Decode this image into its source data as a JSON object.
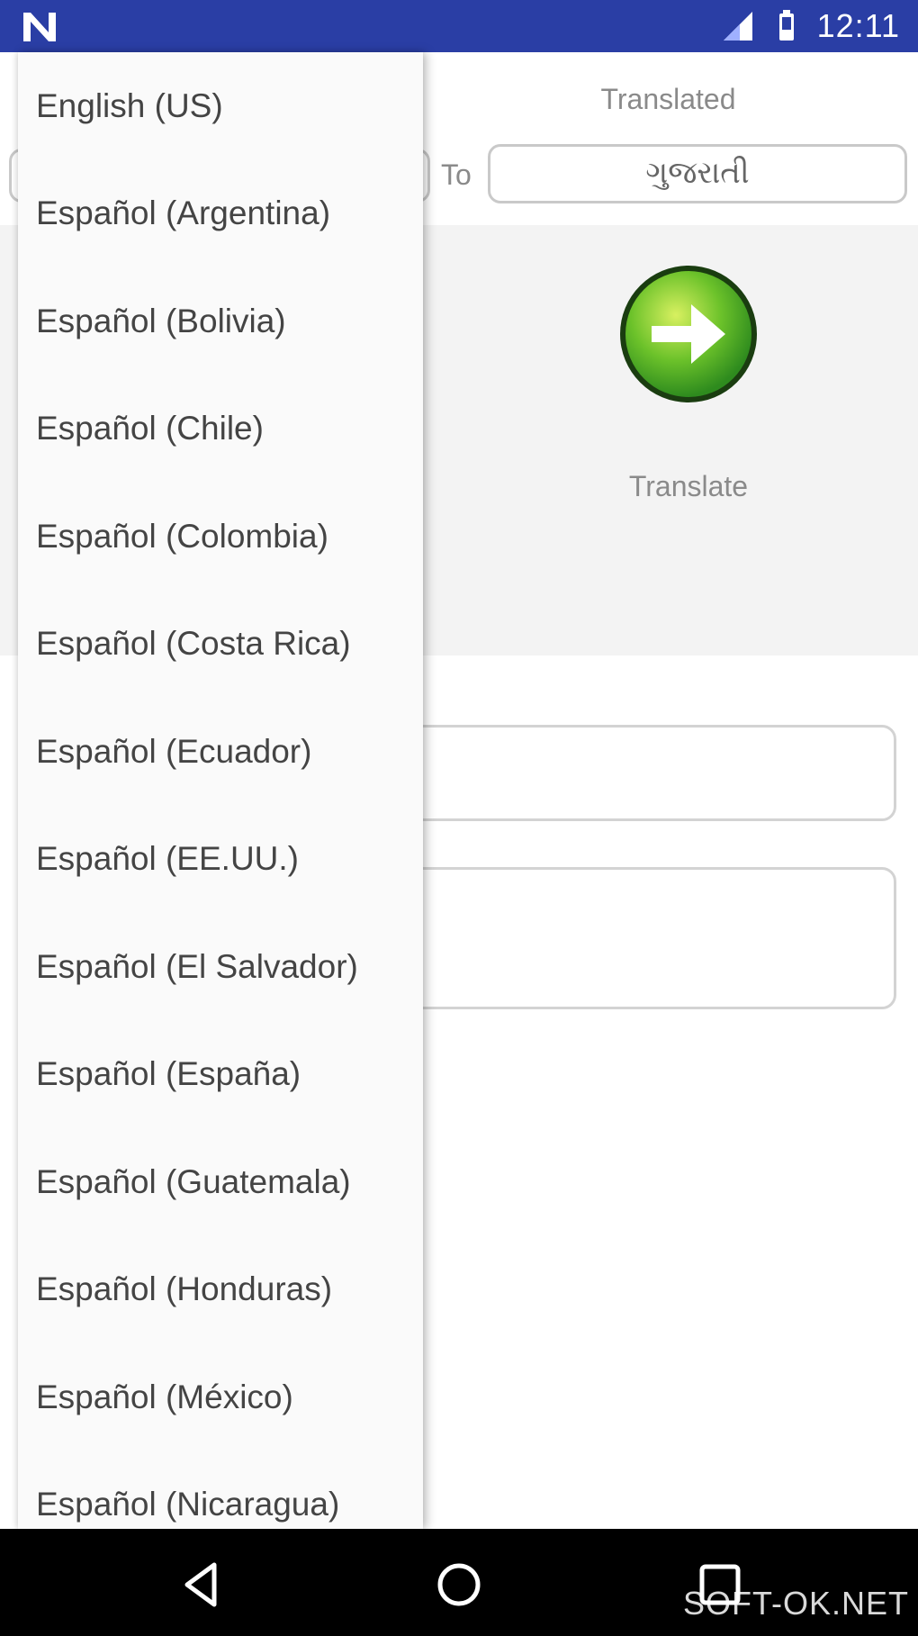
{
  "status_bar": {
    "time": "12:11",
    "icons": [
      "app-n-icon",
      "signal-icon",
      "battery-icon"
    ],
    "color": "#2a3ea5"
  },
  "background": {
    "translated_label": "Translated",
    "to_label": "To",
    "target_language": "ગુજરાતી",
    "translate_label": "Translate",
    "translate_button_icon": "arrow-right-icon"
  },
  "dropdown": {
    "items": [
      "English (US)",
      "Español (Argentina)",
      "Español (Bolivia)",
      "Español (Chile)",
      "Español (Colombia)",
      "Español (Costa Rica)",
      "Español (Ecuador)",
      "Español (EE.UU.)",
      "Español (El Salvador)",
      "Español (España)",
      "Español (Guatemala)",
      "Español (Honduras)",
      "Español (México)",
      "Español (Nicaragua)"
    ]
  },
  "nav_bar": {
    "icons": [
      "back-icon",
      "home-icon",
      "recents-icon"
    ]
  },
  "watermark": "SOFT-OK.NET"
}
